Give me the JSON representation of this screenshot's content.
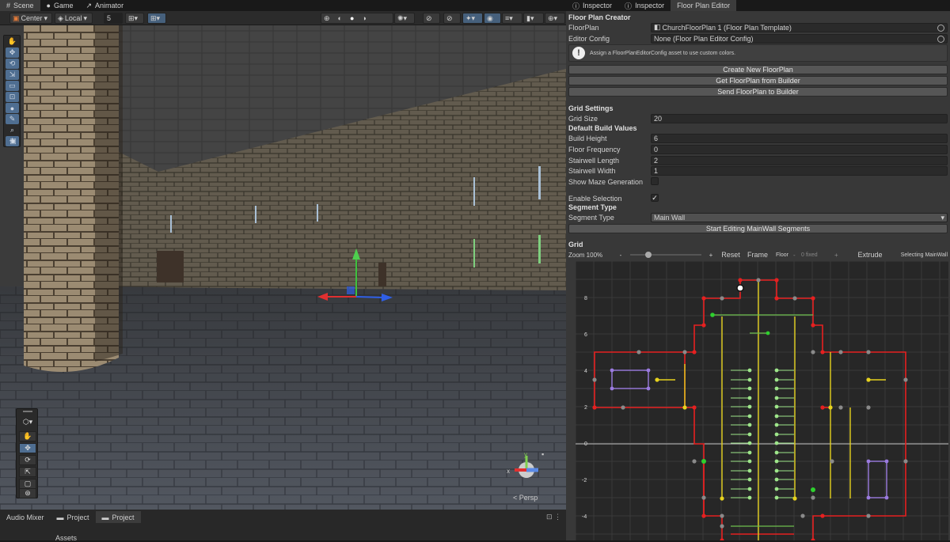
{
  "left_tabs": [
    "Scene",
    "Game",
    "Animator"
  ],
  "right_tabs": [
    "Inspector",
    "Inspector",
    "Floor Plan Editor"
  ],
  "scene_toolbar": {
    "pivot": "Center",
    "space": "Local",
    "snap_value": "5"
  },
  "viewport": {
    "projection": "< Persp",
    "gizmo_axes": [
      "y",
      "x"
    ]
  },
  "bottom_tabs": [
    "Audio Mixer",
    "Project",
    "Project"
  ],
  "assets_label": "Assets",
  "panel": {
    "section_title": "Floor Plan Creator",
    "floorplan_label": "FloorPlan",
    "floorplan_value": "ChurchFloorPlan 1 (Floor Plan Template)",
    "editor_config_label": "Editor Config",
    "editor_config_value": "None (Floor Plan Editor Config)",
    "help_text": "Assign a FloorPlanEditorConfig asset to use custom colors.",
    "buttons": [
      "Create New FloorPlan",
      "Get FloorPlan from Builder",
      "Send FloorPlan to Builder"
    ],
    "grid_settings_title": "Grid Settings",
    "grid_size_label": "Grid Size",
    "grid_size_value": "20",
    "default_build_title": "Default Build Values",
    "build_height_label": "Build Height",
    "build_height_value": "6",
    "floor_frequency_label": "Floor Frequency",
    "floor_frequency_value": "0",
    "stairwell_length_label": "Stairwell Length",
    "stairwell_length_value": "2",
    "stairwell_width_label": "Stairwell Width",
    "stairwell_width_value": "1",
    "show_maze_label": "Show Maze Generation",
    "enable_selection_label": "Enable Selection",
    "segment_type_title": "Segment Type",
    "segment_type_label": "Segment Type",
    "segment_type_value": "Main Wall",
    "start_editing_button": "Start Editing MainWall Segments",
    "grid_title": "Grid",
    "zoom_label": "Zoom 100%",
    "zoom_level": 0.25,
    "reset_button": "Reset",
    "frame_button": "Frame",
    "floor_label": "Floor",
    "floor_value": "0 fixed",
    "extrude_button": "Extrude",
    "selecting_label": "Selecting MainWall",
    "grid_axis_labels": [
      "8",
      "6",
      "4",
      "2",
      "0",
      "-2",
      "-4"
    ]
  },
  "colors": {
    "wall_red": "#e62020",
    "stair_green": "#9ee68a",
    "yellow": "#e6d21e",
    "purple": "#9b7be0",
    "accent_blue": "#4f6e91"
  }
}
